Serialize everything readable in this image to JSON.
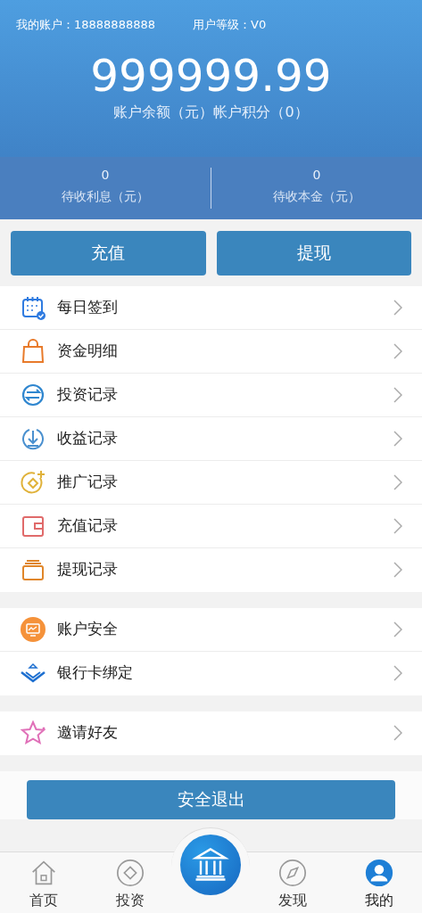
{
  "header": {
    "account_label": "我的账户：18888888888",
    "level_label": "用户等级：V0",
    "balance": "999999.99",
    "balance_caption": "账户余额（元）帐户积分（0）",
    "stats": [
      {
        "value": "0",
        "label": "待收利息（元）"
      },
      {
        "value": "0",
        "label": "待收本金（元）"
      }
    ]
  },
  "actions": [
    "充值",
    "提现"
  ],
  "menu_groups": [
    [
      {
        "kind": "calendar",
        "label": "每日签到"
      },
      {
        "kind": "bag",
        "label": "资金明细"
      },
      {
        "kind": "exchange",
        "label": "投资记录"
      },
      {
        "kind": "download",
        "label": "收益记录"
      },
      {
        "kind": "promote",
        "label": "推广记录"
      },
      {
        "kind": "wallet",
        "label": "充值记录"
      },
      {
        "kind": "stack",
        "label": "提现记录"
      }
    ],
    [
      {
        "kind": "shield",
        "label": "账户安全"
      },
      {
        "kind": "card",
        "label": "银行卡绑定"
      }
    ],
    [
      {
        "kind": "star",
        "label": "邀请好友"
      }
    ]
  ],
  "logout": "安全退出",
  "tabbar": [
    {
      "kind": "home",
      "label": "首页",
      "selected": false
    },
    {
      "kind": "invest",
      "label": "投资",
      "selected": false
    },
    {
      "kind": "center",
      "selected": false
    },
    {
      "kind": "discover",
      "label": "发现",
      "selected": false
    },
    {
      "kind": "me",
      "label": "我的",
      "selected": true
    }
  ]
}
